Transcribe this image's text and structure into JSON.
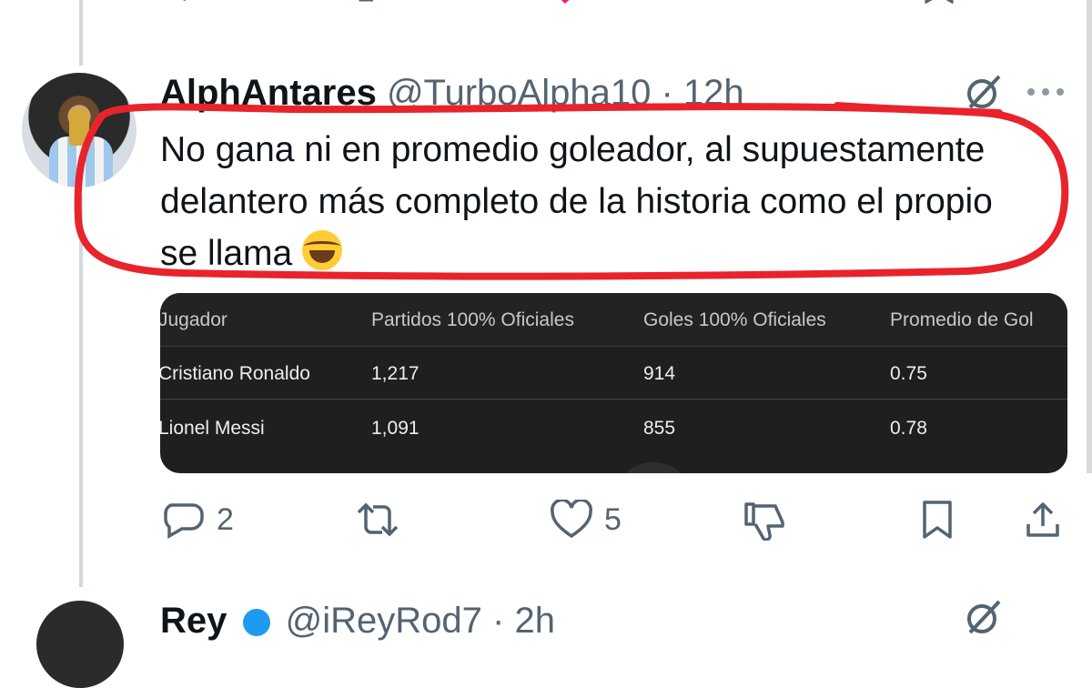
{
  "tweet": {
    "author_name": "AlphAntares",
    "author_handle": "@TurboAlpha10",
    "separator": "·",
    "time": "12h",
    "text": "No gana ni en promedio goleador, al supuestamente delantero más completo de la historia como el propio se llama",
    "emoji": "face-with-tears-of-joy"
  },
  "table": {
    "headers": [
      "Jugador",
      "Partidos 100% Oficiales",
      "Goles 100% Oficiales",
      "Promedio de Gol"
    ],
    "rows": [
      [
        "Cristiano Ronaldo",
        "1,217",
        "914",
        "0.75"
      ],
      [
        "Lionel Messi",
        "1,091",
        "855",
        "0.78"
      ]
    ]
  },
  "actions": {
    "replies": "2",
    "retweets": "",
    "likes": "5"
  },
  "next_tweet": {
    "author_name": "Rey",
    "author_handle": "@iReyRod7",
    "time": "2h"
  },
  "colors": {
    "accent_red": "#e8232b",
    "handle_gray": "#536471",
    "table_bg": "#1f1f1f",
    "like_pink": "#f91880"
  },
  "icons": [
    "reply-icon",
    "retweet-icon",
    "like-icon",
    "dislike-icon",
    "bookmark-icon",
    "share-icon",
    "grok-icon",
    "more-icon",
    "verified-icon"
  ]
}
